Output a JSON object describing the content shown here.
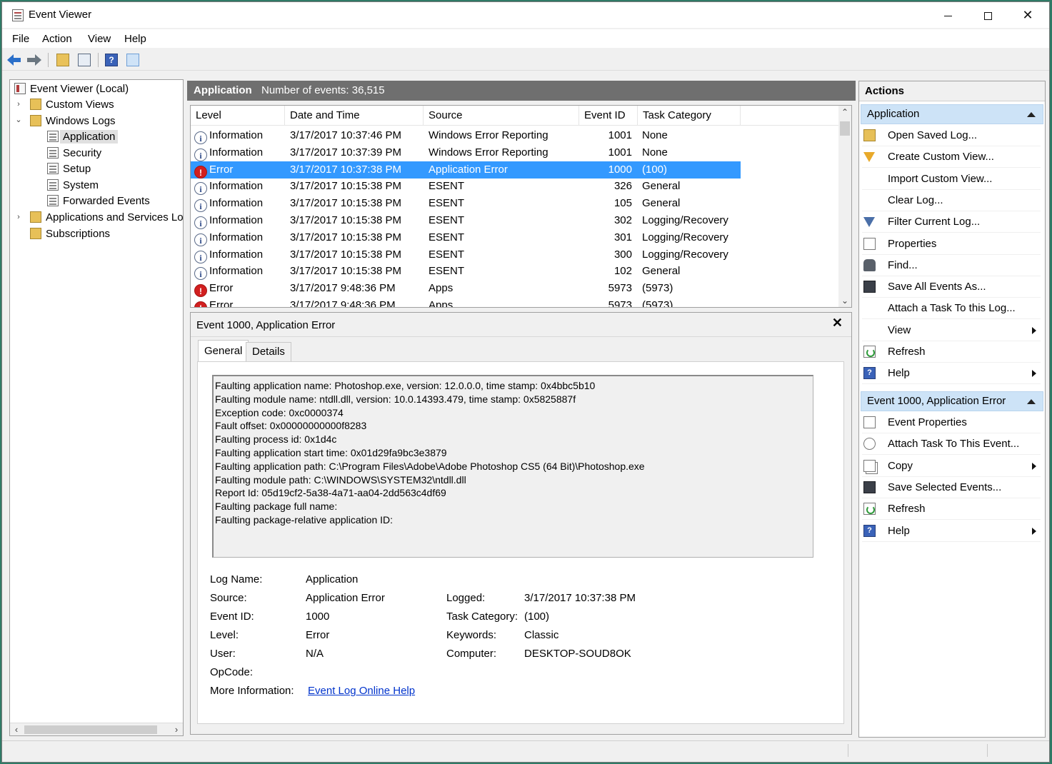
{
  "window": {
    "title": "Event Viewer",
    "controls": {
      "minimize": "",
      "maximize": "",
      "close": "✕"
    }
  },
  "menu": [
    "File",
    "Action",
    "View",
    "Help"
  ],
  "toolbar": {
    "icons": [
      "back-arrow-icon",
      "forward-arrow-icon",
      "folder-up-icon",
      "show-hide-console-tree-icon",
      "help-icon",
      "show-hide-action-pane-icon"
    ]
  },
  "tree": {
    "root": "Event Viewer (Local)",
    "custom_views": "Custom Views",
    "windows_logs": "Windows Logs",
    "logs": [
      "Application",
      "Security",
      "Setup",
      "System",
      "Forwarded Events"
    ],
    "selected": "Application",
    "app_services": "Applications and Services Lo",
    "subscriptions": "Subscriptions"
  },
  "center": {
    "log_name": "Application",
    "event_count": "Number of events: 36,515",
    "columns": [
      "Level",
      "Date and Time",
      "Source",
      "Event ID",
      "Task Category"
    ],
    "rows": [
      {
        "level": "Information",
        "type": "info",
        "date": "3/17/2017 10:37:46 PM",
        "source": "Windows Error Reporting",
        "event_id": "1001",
        "category": "None"
      },
      {
        "level": "Information",
        "type": "info",
        "date": "3/17/2017 10:37:39 PM",
        "source": "Windows Error Reporting",
        "event_id": "1001",
        "category": "None"
      },
      {
        "level": "Error",
        "type": "err",
        "date": "3/17/2017 10:37:38 PM",
        "source": "Application Error",
        "event_id": "1000",
        "category": "(100)"
      },
      {
        "level": "Information",
        "type": "info",
        "date": "3/17/2017 10:15:38 PM",
        "source": "ESENT",
        "event_id": "326",
        "category": "General"
      },
      {
        "level": "Information",
        "type": "info",
        "date": "3/17/2017 10:15:38 PM",
        "source": "ESENT",
        "event_id": "105",
        "category": "General"
      },
      {
        "level": "Information",
        "type": "info",
        "date": "3/17/2017 10:15:38 PM",
        "source": "ESENT",
        "event_id": "302",
        "category": "Logging/Recovery"
      },
      {
        "level": "Information",
        "type": "info",
        "date": "3/17/2017 10:15:38 PM",
        "source": "ESENT",
        "event_id": "301",
        "category": "Logging/Recovery"
      },
      {
        "level": "Information",
        "type": "info",
        "date": "3/17/2017 10:15:38 PM",
        "source": "ESENT",
        "event_id": "300",
        "category": "Logging/Recovery"
      },
      {
        "level": "Information",
        "type": "info",
        "date": "3/17/2017 10:15:38 PM",
        "source": "ESENT",
        "event_id": "102",
        "category": "General"
      },
      {
        "level": "Error",
        "type": "err",
        "date": "3/17/2017 9:48:36 PM",
        "source": "Apps",
        "event_id": "5973",
        "category": "(5973)"
      },
      {
        "level": "Error",
        "type": "err",
        "date": "3/17/2017 9:48:36 PM",
        "source": "Apps",
        "event_id": "5973",
        "category": "(5973)"
      }
    ],
    "selected_row": 2
  },
  "detail": {
    "title": "Event 1000, Application Error",
    "close": "✕",
    "tabs": [
      "General",
      "Details"
    ],
    "active_tab": "General",
    "description": [
      "Faulting application name: Photoshop.exe, version: 12.0.0.0, time stamp: 0x4bbc5b10",
      "Faulting module name: ntdll.dll, version: 10.0.14393.479, time stamp: 0x5825887f",
      "Exception code: 0xc0000374",
      "Fault offset: 0x00000000000f8283",
      "Faulting process id: 0x1d4c",
      "Faulting application start time: 0x01d29fa9bc3e3879",
      "Faulting application path: C:\\Program Files\\Adobe\\Adobe Photoshop CS5 (64 Bit)\\Photoshop.exe",
      "Faulting module path: C:\\WINDOWS\\SYSTEM32\\ntdll.dll",
      "Report Id: 05d19cf2-5a38-4a71-aa04-2dd563c4df69",
      "Faulting package full name:",
      "Faulting package-relative application ID:"
    ],
    "props": {
      "log_name_label": "Log Name:",
      "log_name": "Application",
      "source_label": "Source:",
      "source": "Application Error",
      "event_id_label": "Event ID:",
      "event_id": "1000",
      "level_label": "Level:",
      "level": "Error",
      "user_label": "User:",
      "user": "N/A",
      "opcode_label": "OpCode:",
      "opcode": "",
      "more_info_label": "More Information:",
      "more_info_link": "Event Log Online Help",
      "logged_label": "Logged:",
      "logged": "3/17/2017 10:37:38 PM",
      "task_category_label": "Task Category:",
      "task_category": "(100)",
      "keywords_label": "Keywords:",
      "keywords": "Classic",
      "computer_label": "Computer:",
      "computer": "DESKTOP-SOUD8OK"
    }
  },
  "actions": {
    "title": "Actions",
    "section1": {
      "title": "Application",
      "items": [
        {
          "label": "Open Saved Log...",
          "icon": "folder-open-icon"
        },
        {
          "label": "Create Custom View...",
          "icon": "filter-icon"
        },
        {
          "label": "Import Custom View...",
          "icon": ""
        },
        {
          "label": "Clear Log...",
          "icon": ""
        },
        {
          "label": "Filter Current Log...",
          "icon": "filter-icon"
        },
        {
          "label": "Properties",
          "icon": "properties-icon"
        },
        {
          "label": "Find...",
          "icon": "binoculars-icon"
        },
        {
          "label": "Save All Events As...",
          "icon": "save-icon"
        },
        {
          "label": "Attach a Task To this Log...",
          "icon": ""
        },
        {
          "label": "View",
          "icon": "",
          "submenu": true
        },
        {
          "label": "Refresh",
          "icon": "refresh-icon"
        },
        {
          "label": "Help",
          "icon": "help-icon",
          "submenu": true
        }
      ]
    },
    "section2": {
      "title": "Event 1000, Application Error",
      "items": [
        {
          "label": "Event Properties",
          "icon": "properties-icon"
        },
        {
          "label": "Attach Task To This Event...",
          "icon": "task-icon"
        },
        {
          "label": "Copy",
          "icon": "copy-icon",
          "submenu": true
        },
        {
          "label": "Save Selected Events...",
          "icon": "save-icon"
        },
        {
          "label": "Refresh",
          "icon": "refresh-icon"
        },
        {
          "label": "Help",
          "icon": "help-icon",
          "submenu": true
        }
      ]
    }
  },
  "colors": {
    "selection": "#3399ff",
    "section_header": "#cde3f7",
    "pane_header": "#6f6f6f",
    "link": "#0033cc",
    "error": "#d21f1f"
  }
}
